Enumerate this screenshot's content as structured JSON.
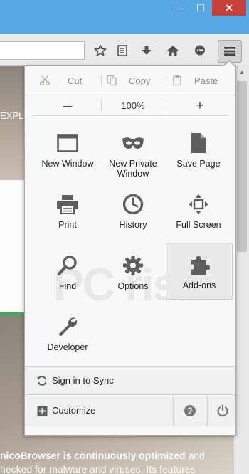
{
  "page": {
    "explore_text": "EXPL",
    "bottom_text_bold_prefix": "nicoBrowser is continuously optimized",
    "bottom_text_suffix": " and",
    "bottom_text_line2": "hecked for malware and viruses. Its features"
  },
  "window": {
    "minimize_glyph": "—",
    "maximize_glyph": "☐",
    "close_glyph": "✕"
  },
  "menu": {
    "edit": {
      "cut": "Cut",
      "copy": "Copy",
      "paste": "Paste"
    },
    "zoom": {
      "minus": "—",
      "level": "100%",
      "plus": "+"
    },
    "items": [
      {
        "label": "New Window",
        "icon": "window-icon"
      },
      {
        "label": "New Private Window",
        "icon": "mask-icon"
      },
      {
        "label": "Save Page",
        "icon": "page-icon"
      },
      {
        "label": "Print",
        "icon": "printer-icon"
      },
      {
        "label": "History",
        "icon": "clock-icon"
      },
      {
        "label": "Full Screen",
        "icon": "fullscreen-icon"
      },
      {
        "label": "Find",
        "icon": "magnifier-icon"
      },
      {
        "label": "Options",
        "icon": "gear-icon"
      },
      {
        "label": "Add-ons",
        "icon": "puzzle-icon"
      },
      {
        "label": "Developer",
        "icon": "wrench-icon"
      }
    ],
    "sync": "Sign in to Sync",
    "customize": "Customize"
  },
  "colors": {
    "titlebar": "#57a7e4",
    "close": "#c7403a",
    "icon": "#5e5e5e",
    "green_strip": "#4aa55e"
  }
}
